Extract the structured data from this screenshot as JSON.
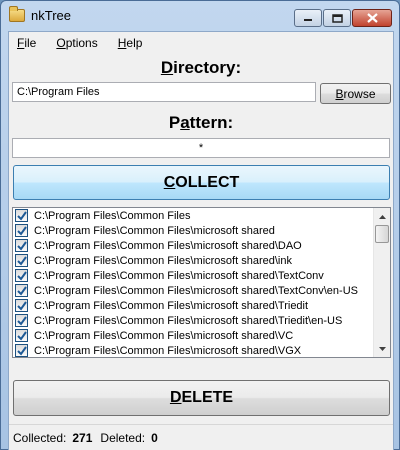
{
  "window": {
    "title": "nkTree"
  },
  "menu": {
    "file": {
      "accel": "F",
      "rest": "ile"
    },
    "options": {
      "accel": "O",
      "rest": "ptions"
    },
    "help": {
      "accel": "H",
      "rest": "elp"
    }
  },
  "directory": {
    "heading_accel": "D",
    "heading_rest": "irectory:",
    "value": "C:\\Program Files",
    "browse_accel": "B",
    "browse_rest": "rowse"
  },
  "pattern": {
    "heading_pre": "P",
    "heading_accel": "a",
    "heading_rest": "ttern:",
    "value": "*"
  },
  "collect_button": {
    "accel": "C",
    "rest": "OLLECT"
  },
  "delete_button": {
    "accel": "D",
    "rest": "ELETE"
  },
  "list": {
    "items": [
      {
        "path": "C:\\Program Files\\Common Files",
        "checked": true
      },
      {
        "path": "C:\\Program Files\\Common Files\\microsoft shared",
        "checked": true
      },
      {
        "path": "C:\\Program Files\\Common Files\\microsoft shared\\DAO",
        "checked": true
      },
      {
        "path": "C:\\Program Files\\Common Files\\microsoft shared\\ink",
        "checked": true
      },
      {
        "path": "C:\\Program Files\\Common Files\\microsoft shared\\TextConv",
        "checked": true
      },
      {
        "path": "C:\\Program Files\\Common Files\\microsoft shared\\TextConv\\en-US",
        "checked": true
      },
      {
        "path": "C:\\Program Files\\Common Files\\microsoft shared\\Triedit",
        "checked": true
      },
      {
        "path": "C:\\Program Files\\Common Files\\microsoft shared\\Triedit\\en-US",
        "checked": true
      },
      {
        "path": "C:\\Program Files\\Common Files\\microsoft shared\\VC",
        "checked": true
      },
      {
        "path": "C:\\Program Files\\Common Files\\microsoft shared\\VGX",
        "checked": true
      }
    ]
  },
  "status": {
    "collected_label": "Collected:",
    "collected_value": "271",
    "deleted_label": "Deleted:",
    "deleted_value": "0"
  },
  "icons": {
    "app": "folder-icon",
    "minimize": "minimize-icon",
    "maximize": "maximize-icon",
    "close": "close-icon",
    "checkbox": "checkmark-icon"
  },
  "colors": {
    "titlebar": "#b3cbe8",
    "collect_accent": "#bee6fd",
    "checkmark": "#1e5a96"
  }
}
